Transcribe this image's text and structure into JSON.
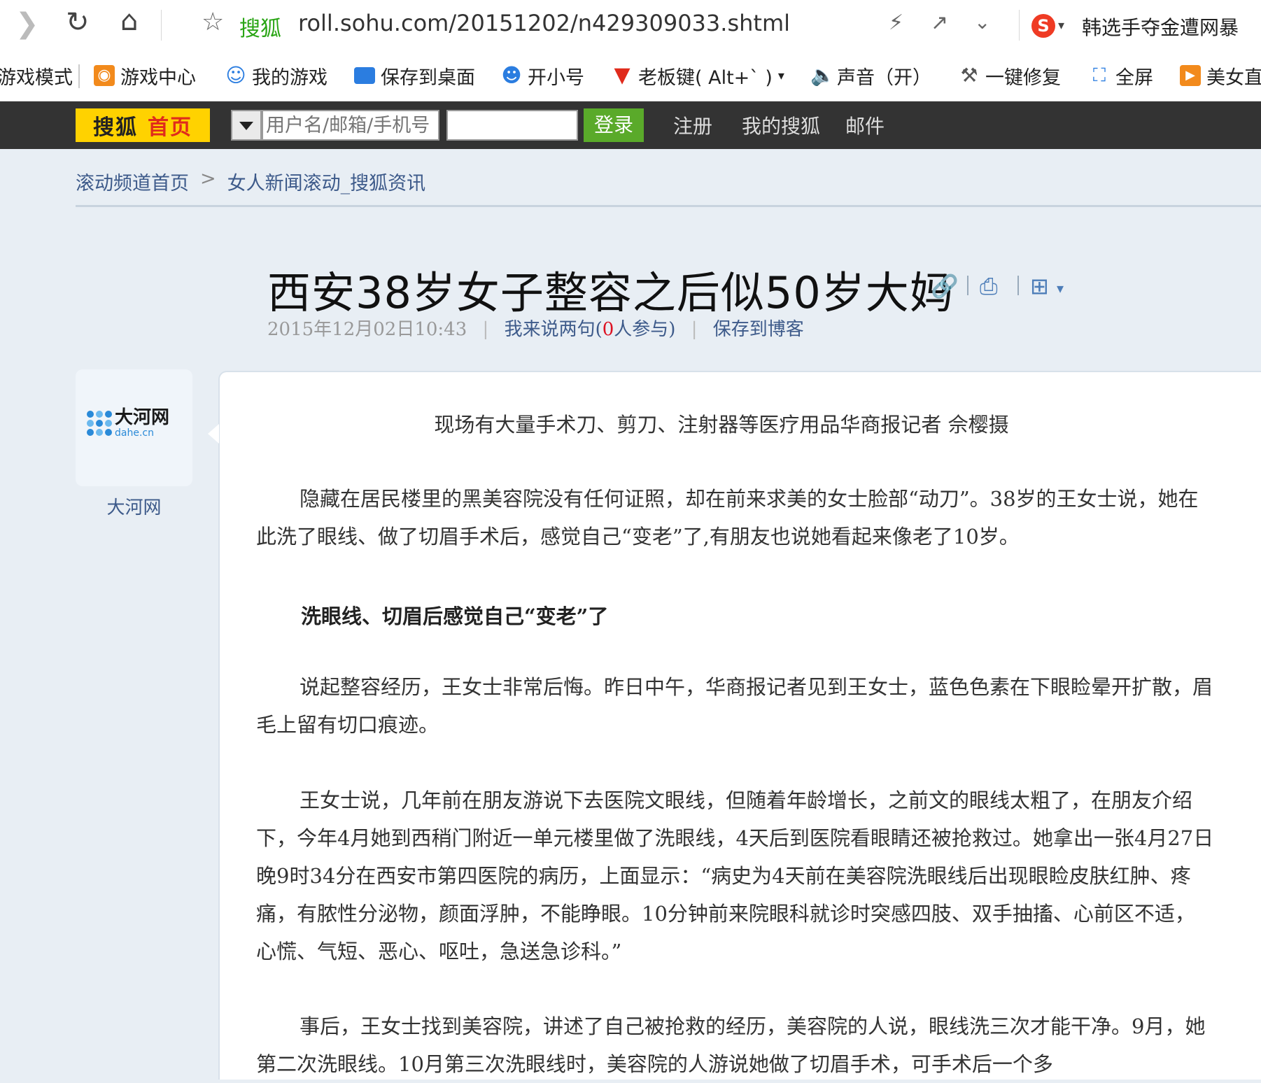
{
  "browser": {
    "url": "roll.sohu.com/20151202/n429309033.shtml",
    "site_name": "搜狐",
    "right_text": "韩选手夺金遭网暴"
  },
  "toolbar": {
    "items": [
      {
        "label": "游戏模式",
        "icon": "gamepad-mode-icon"
      },
      {
        "label": "游戏中心",
        "icon": "game-center-icon"
      },
      {
        "label": "我的游戏",
        "icon": "user-icon"
      },
      {
        "label": "保存到桌面",
        "icon": "monitor-icon"
      },
      {
        "label": "开小号",
        "icon": "users-icon"
      },
      {
        "label": "老板键( Alt+` )",
        "icon": "tie-icon"
      },
      {
        "label": "声音（开）",
        "icon": "speaker-icon"
      },
      {
        "label": "一键修复",
        "icon": "wrench-icon"
      },
      {
        "label": "全屏",
        "icon": "fullscreen-icon"
      },
      {
        "label": "美女直",
        "icon": "play-icon"
      }
    ]
  },
  "sohubar": {
    "home_a": "搜狐",
    "home_b": "首页",
    "user_placeholder": "用户名/邮箱/手机号",
    "login": "登录",
    "links": [
      "注册",
      "我的搜狐",
      "邮件"
    ]
  },
  "breadcrumb": {
    "home": "滚动频道首页",
    "sep": ">",
    "current": "女人新闻滚动_搜狐资讯"
  },
  "article": {
    "title": "西安38岁女子整容之后似50岁大妈",
    "date": "2015年12月02日10:43",
    "comment_pre": "我来说两句(",
    "comment_count": "0",
    "comment_post": "人参与)",
    "save_blog": "保存到博客",
    "source": "大河网",
    "logo_text": "大河网",
    "logo_sub": "dahe.cn",
    "caption": "现场有大量手术刀、剪刀、注射器等医疗用品华商报记者  佘樱摄",
    "p1": "隐藏在居民楼里的黑美容院没有任何证照，却在前来求美的女士脸部“动刀”。38岁的王女士说，她在此洗了眼线、做了切眉手术后，感觉自己“变老”了,有朋友也说她看起来像老了10岁。",
    "heading": "洗眼线、切眉后感觉自己“变老”了",
    "p2": "说起整容经历，王女士非常后悔。昨日中午，华商报记者见到王女士，蓝色色素在下眼睑晕开扩散，眉毛上留有切口痕迹。",
    "p3": "王女士说，几年前在朋友游说下去医院文眼线，但随着年龄增长，之前文的眼线太粗了，在朋友介绍下，今年4月她到西稍门附近一单元楼里做了洗眼线，4天后到医院看眼睛还被抢救过。她拿出一张4月27日晚9时34分在西安市第四医院的病历，上面显示：“病史为4天前在美容院洗眼线后出现眼睑皮肤红肿、疼痛，有脓性分泌物，颜面浮肿，不能睁眼。10分钟前来院眼科就诊时突感四肢、双手抽搐、心前区不适，心慌、气短、恶心、呕吐，急送急诊科。”",
    "p4": "事后，王女士找到美容院，讲述了自己被抢救的经历，美容院的人说，眼线洗三次才能干净。9月，她第二次洗眼线。10月第三次洗眼线时，美容院的人游说她做了切眉手术，可手术后一个多"
  }
}
